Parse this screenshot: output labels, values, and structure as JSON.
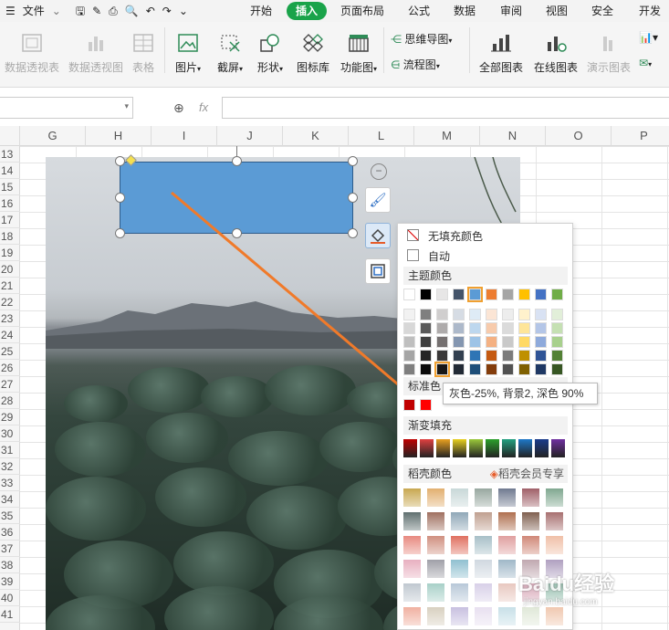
{
  "menu": {
    "file_label": "文件",
    "tabs": [
      "开始",
      "插入",
      "页面布局",
      "公式",
      "数据",
      "审阅",
      "视图",
      "安全",
      "开发工"
    ],
    "active_tab": "插入"
  },
  "ribbon": {
    "items": [
      {
        "label": "数据透视表",
        "icon": "pivot-table-icon",
        "disabled": true
      },
      {
        "label": "数据透视图",
        "icon": "pivot-chart-icon",
        "disabled": true
      },
      {
        "label": "表格",
        "icon": "table-icon",
        "disabled": true
      },
      {
        "label": "图片",
        "icon": "picture-icon",
        "disabled": false
      },
      {
        "label": "截屏",
        "icon": "screenshot-icon",
        "disabled": false
      },
      {
        "label": "形状",
        "icon": "shapes-icon",
        "disabled": false
      },
      {
        "label": "图标库",
        "icon": "icon-library-icon",
        "disabled": false
      },
      {
        "label": "功能图",
        "icon": "function-chart-icon",
        "disabled": false
      },
      {
        "label": "思维导图",
        "icon": "mindmap-icon",
        "disabled": false
      },
      {
        "label": "流程图",
        "icon": "flowchart-icon",
        "disabled": false
      },
      {
        "label": "全部图表",
        "icon": "all-charts-icon",
        "disabled": false
      },
      {
        "label": "在线图表",
        "icon": "online-chart-icon",
        "disabled": false
      },
      {
        "label": "演示图表",
        "icon": "demo-chart-icon",
        "disabled": true
      }
    ]
  },
  "formula_bar": {
    "fx_label": "fx",
    "cell_ref": "",
    "content": ""
  },
  "sheet": {
    "columns": [
      "G",
      "H",
      "I",
      "J",
      "K",
      "L",
      "M",
      "N",
      "O",
      "P"
    ],
    "rows": [
      "13",
      "14",
      "15",
      "16",
      "17",
      "18",
      "19",
      "20",
      "21",
      "22",
      "23",
      "24",
      "25",
      "26",
      "27",
      "28",
      "29",
      "30",
      "31",
      "32",
      "33",
      "34",
      "35",
      "36",
      "37",
      "38",
      "39",
      "40",
      "41"
    ]
  },
  "fill_panel": {
    "no_fill_label": "无填充颜色",
    "auto_label": "自动",
    "theme_title": "主题颜色",
    "standard_title": "标准色",
    "gradient_title": "渐变填充",
    "daoke_title": "稻壳颜色",
    "member_label": "稻壳会员专享",
    "theme_top": [
      "#ffffff",
      "#000000",
      "#e7e6e6",
      "#44546a",
      "#5b9bd5",
      "#ed7d31",
      "#a5a5a5",
      "#ffc000",
      "#4472c4",
      "#70ad47"
    ],
    "theme_shades": [
      [
        "#f2f2f2",
        "#7f7f7f",
        "#d0cece",
        "#d6dce4",
        "#deebf6",
        "#fbe5d5",
        "#ededed",
        "#fff2cc",
        "#d9e2f3",
        "#e2efd9"
      ],
      [
        "#d8d8d8",
        "#595959",
        "#aeabab",
        "#adb9ca",
        "#bdd7ee",
        "#f7cbac",
        "#dbdbdb",
        "#fee599",
        "#b4c6e7",
        "#c5e0b3"
      ],
      [
        "#bfbfbf",
        "#3f3f3f",
        "#757070",
        "#8496b0",
        "#9dc3e6",
        "#f4b183",
        "#c9c9c9",
        "#ffd965",
        "#8eaadb",
        "#a8d08d"
      ],
      [
        "#a5a5a5",
        "#262626",
        "#3a3838",
        "#323f4f",
        "#2e75b5",
        "#c55a11",
        "#7b7b7b",
        "#bf9000",
        "#2f5496",
        "#538135"
      ],
      [
        "#7f7f7f",
        "#0c0c0c",
        "#171616",
        "#222a35",
        "#1e4e79",
        "#833c0b",
        "#525252",
        "#7f6000",
        "#1f3864",
        "#375623"
      ]
    ],
    "standard_colors": [
      "#c00000",
      "#ff0000"
    ],
    "gradients": [
      "#c00000",
      "#e04040",
      "#e8a020",
      "#e8d020",
      "#9ac83a",
      "#2ca02c",
      "#22a080",
      "#1e78c8",
      "#1a3c8c",
      "#7030a0"
    ],
    "daoke_colors": [
      [
        "#c8a850",
        "#e2b070",
        "#c8d8d8",
        "#98a8a0",
        "#707a90",
        "#a06068",
        "#80a890"
      ],
      [
        "#607070",
        "#a07060",
        "#90a8b8",
        "#c0a090",
        "#b07050",
        "#806050",
        "#a87070"
      ],
      [
        "#e88a80",
        "#d09080",
        "#e07060",
        "#a8c0c8",
        "#e0a0a0",
        "#d08878",
        "#f0c0a8"
      ],
      [
        "#e8b0c0",
        "#a0a0a8",
        "#90c0d0",
        "#d0d8e0",
        "#a0b8c8",
        "#c0a8b0",
        "#b0a0c0"
      ],
      [
        "#c0c8d0",
        "#a8d0c8",
        "#b8c8d8",
        "#d8d0e8",
        "#e8c8c0",
        "#d8a8b8",
        "#98c0b0"
      ],
      [
        "#f0b0a0",
        "#d8d0c0",
        "#c8c0e0",
        "#e8e0f0",
        "#c8e0e8",
        "#e0e8d8",
        "#f0c8b0"
      ]
    ]
  },
  "tooltip": {
    "text": "灰色-25%, 背景2, 深色 90%"
  },
  "shape": {
    "fill_color": "#5b9bd5"
  },
  "watermark": {
    "text": "Baidu经验",
    "url": "jingyan.baidu.com"
  }
}
